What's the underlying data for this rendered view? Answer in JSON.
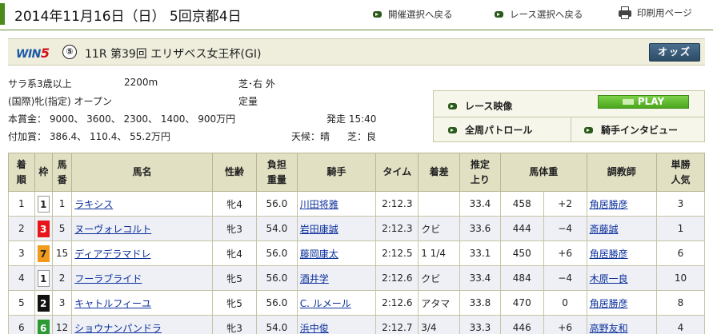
{
  "header": {
    "date": "2014年11月16日（日） 5回京都4日",
    "links": [
      "開催選択へ戻る",
      "レース選択へ戻る",
      "印刷用ページ"
    ]
  },
  "race": {
    "win5": "WIN",
    "win5_num": "5",
    "win5_leg": "⑤",
    "title": "11R  第39回 エリザベス女王杯(GI)",
    "odds_label": "オッズ"
  },
  "info": {
    "line1_a": "サラ系3歳以上",
    "line1_b": "2200m",
    "line1_c": "芝･右 外",
    "line2_a": "(国際)牝(指定) オープン",
    "line2_b": "定量",
    "line3_a": "本賞金：  9000、 3600、 2300、 1400、 900万円",
    "line3_b": "発走 15:40",
    "line4_a": "付加賞：  386.4、 110.4、 55.2万円",
    "line4_b": "天候：晴",
    "line4_c": "芝：良"
  },
  "video": {
    "race_video": "レース映像",
    "play": "PLAY",
    "patrol": "全周パトロール",
    "interview": "騎手インタビュー"
  },
  "table": {
    "headers": {
      "rank": [
        "着",
        "順"
      ],
      "waku": "枠",
      "umaban": [
        "馬",
        "番"
      ],
      "name": "馬名",
      "sexage": "性齢",
      "weight": [
        "負担",
        "重量"
      ],
      "jockey": "騎手",
      "time": "タイム",
      "margin": "着差",
      "last3f": [
        "推定",
        "上り"
      ],
      "bodyweight": "馬体重",
      "trainer": "調教師",
      "pop": [
        "単勝",
        "人気"
      ]
    },
    "rows": [
      {
        "rank": "1",
        "waku": "1",
        "waku_bg": "#ffffff",
        "waku_fg": "#222222",
        "umaban": "1",
        "name": "ラキシス",
        "sexage": "牝4",
        "weight": "56.0",
        "jockey": "川田将雅",
        "time": "2:12.3",
        "margin": "",
        "last3f": "33.4",
        "bw": "458",
        "bwdiff": "+2",
        "trainer": "角居勝彦",
        "pop": "3"
      },
      {
        "rank": "2",
        "waku": "3",
        "waku_bg": "#e8141a",
        "waku_fg": "#ffffff",
        "umaban": "5",
        "name": "ヌーヴォレコルト",
        "sexage": "牝3",
        "weight": "54.0",
        "jockey": "岩田康誠",
        "time": "2:12.3",
        "margin": "クビ",
        "last3f": "33.6",
        "bw": "444",
        "bwdiff": "−4",
        "trainer": "斎藤誠",
        "pop": "1"
      },
      {
        "rank": "3",
        "waku": "7",
        "waku_bg": "#f29a1c",
        "waku_fg": "#222222",
        "umaban": "15",
        "name": "ディアデラマドレ",
        "sexage": "牝4",
        "weight": "56.0",
        "jockey": "藤岡康太",
        "time": "2:12.5",
        "margin": "1 1/4",
        "last3f": "33.1",
        "bw": "450",
        "bwdiff": "+6",
        "trainer": "角居勝彦",
        "pop": "6"
      },
      {
        "rank": "4",
        "waku": "1",
        "waku_bg": "#ffffff",
        "waku_fg": "#222222",
        "umaban": "2",
        "name": "フーラブライド",
        "sexage": "牝5",
        "weight": "56.0",
        "jockey": "酒井学",
        "time": "2:12.6",
        "margin": "クビ",
        "last3f": "33.4",
        "bw": "484",
        "bwdiff": "−4",
        "trainer": "木原一良",
        "pop": "10"
      },
      {
        "rank": "5",
        "waku": "2",
        "waku_bg": "#111111",
        "waku_fg": "#ffffff",
        "umaban": "3",
        "name": "キャトルフィーユ",
        "sexage": "牝5",
        "weight": "56.0",
        "jockey": "C. ルメール",
        "time": "2:12.6",
        "margin": "アタマ",
        "last3f": "33.8",
        "bw": "470",
        "bwdiff": "0",
        "trainer": "角居勝彦",
        "pop": "8"
      },
      {
        "rank": "6",
        "waku": "6",
        "waku_bg": "#2c9a33",
        "waku_fg": "#ffffff",
        "umaban": "12",
        "name": "ショウナンパンドラ",
        "sexage": "牝3",
        "weight": "54.0",
        "jockey": "浜中俊",
        "time": "2:12.7",
        "margin": "3/4",
        "last3f": "33.3",
        "bw": "446",
        "bwdiff": "+6",
        "trainer": "高野友和",
        "pop": "4"
      }
    ]
  },
  "colors": {
    "accent_green": "#4d8a1c",
    "header_bg": "#e2e0c3",
    "row_alt": "#eef0f6",
    "link": "#0b2f9b"
  }
}
